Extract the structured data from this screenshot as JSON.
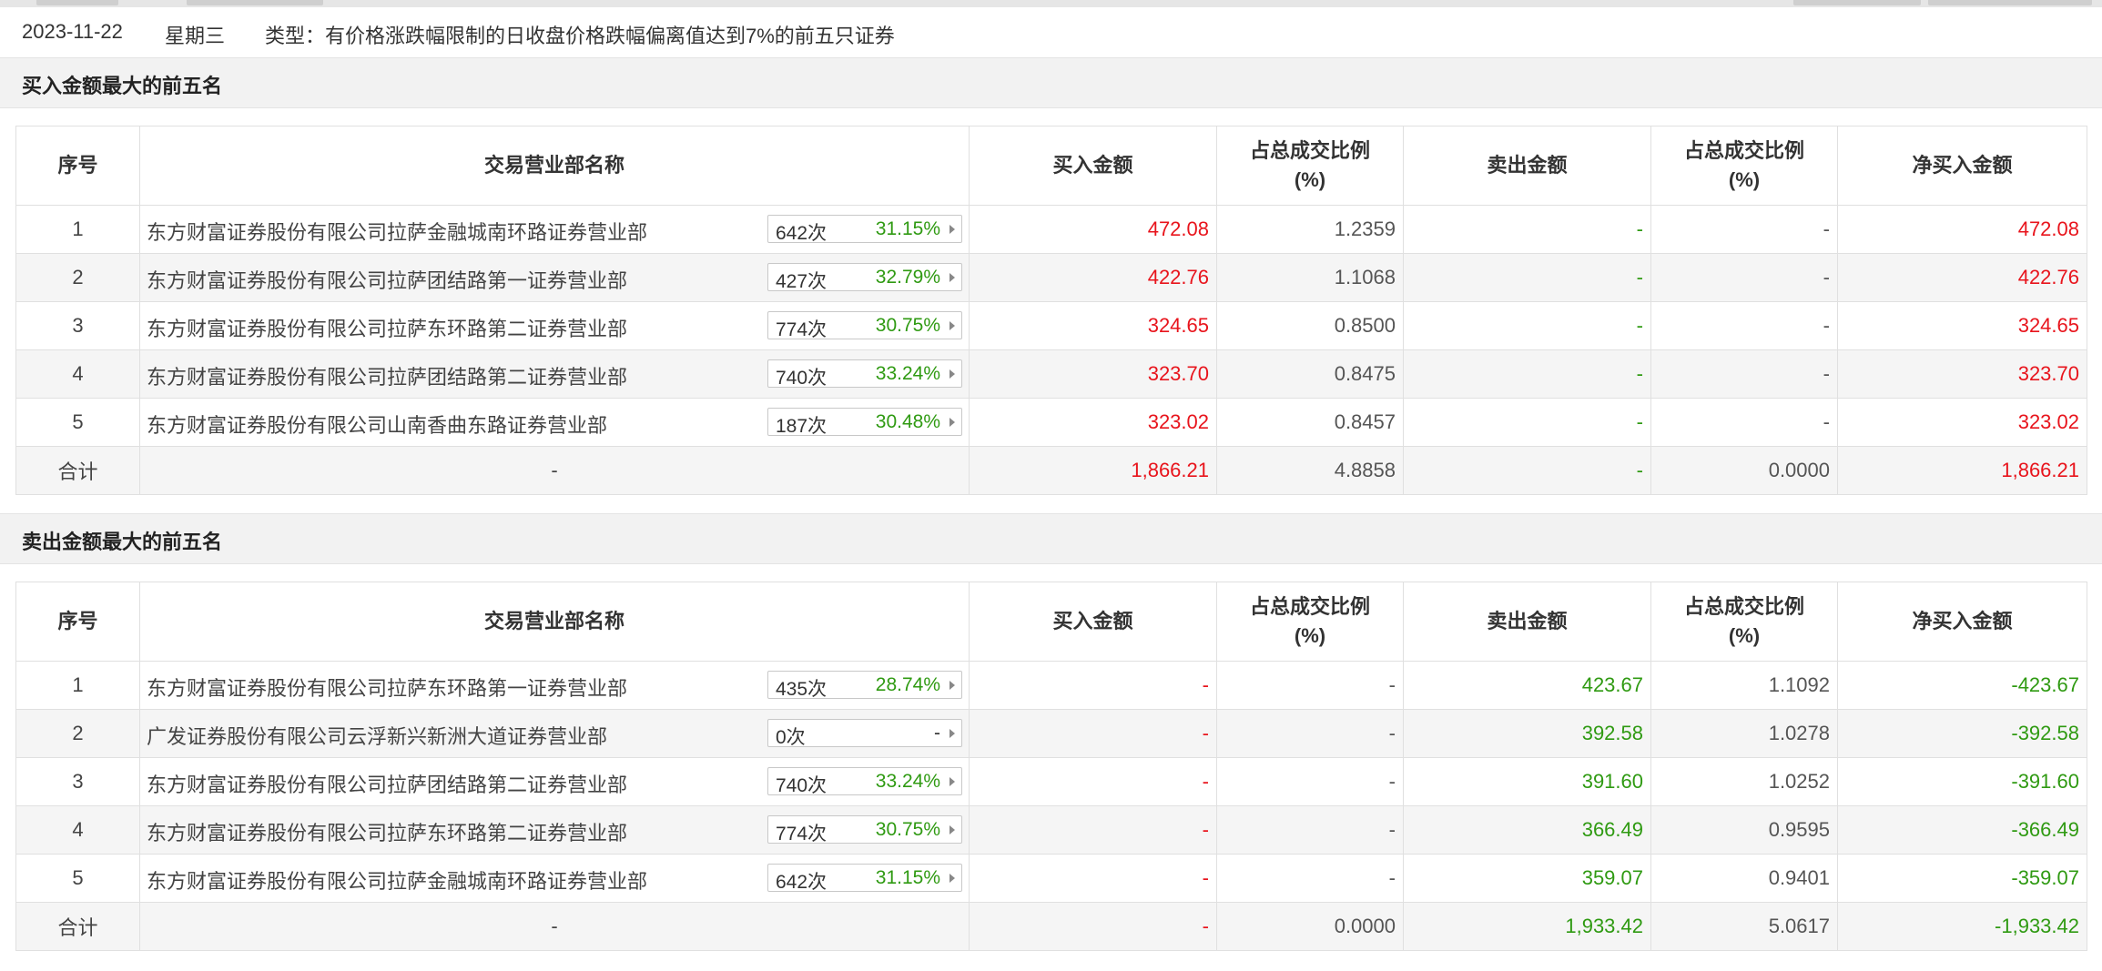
{
  "colors": {
    "red": "#e8141c",
    "green": "#2f9a12"
  },
  "info": {
    "date": "2023-11-22",
    "weekday": "星期三",
    "type_text": "类型：有价格涨跌幅限制的日收盘价格跌幅偏离值达到7%的前五只证券"
  },
  "columns": {
    "seq": "序号",
    "dept": "交易营业部名称",
    "buy": "买入金额",
    "ratio1_line1": "占总成交比例",
    "ratio1_line2": "(%)",
    "sell": "卖出金额",
    "ratio2_line1": "占总成交比例",
    "ratio2_line2": "(%)",
    "net": "净买入金额"
  },
  "buy_section": {
    "title": "买入金额最大的前五名",
    "rows": [
      {
        "seq": "1",
        "name": "东方财富证券股份有限公司拉萨金融城南环路证券营业部",
        "count": "642次",
        "pct": "31.15%",
        "buy": "472.08",
        "buy_ratio": "1.2359",
        "sell": "-",
        "sell_ratio": "-",
        "net": "472.08"
      },
      {
        "seq": "2",
        "name": "东方财富证券股份有限公司拉萨团结路第一证券营业部",
        "count": "427次",
        "pct": "32.79%",
        "buy": "422.76",
        "buy_ratio": "1.1068",
        "sell": "-",
        "sell_ratio": "-",
        "net": "422.76"
      },
      {
        "seq": "3",
        "name": "东方财富证券股份有限公司拉萨东环路第二证券营业部",
        "count": "774次",
        "pct": "30.75%",
        "buy": "324.65",
        "buy_ratio": "0.8500",
        "sell": "-",
        "sell_ratio": "-",
        "net": "324.65"
      },
      {
        "seq": "4",
        "name": "东方财富证券股份有限公司拉萨团结路第二证券营业部",
        "count": "740次",
        "pct": "33.24%",
        "buy": "323.70",
        "buy_ratio": "0.8475",
        "sell": "-",
        "sell_ratio": "-",
        "net": "323.70"
      },
      {
        "seq": "5",
        "name": "东方财富证券股份有限公司山南香曲东路证券营业部",
        "count": "187次",
        "pct": "30.48%",
        "buy": "323.02",
        "buy_ratio": "0.8457",
        "sell": "-",
        "sell_ratio": "-",
        "net": "323.02"
      }
    ],
    "total": {
      "label": "合计",
      "name": "-",
      "buy": "1,866.21",
      "buy_ratio": "4.8858",
      "sell": "-",
      "sell_ratio": "0.0000",
      "net": "1,866.21"
    }
  },
  "sell_section": {
    "title": "卖出金额最大的前五名",
    "rows": [
      {
        "seq": "1",
        "name": "东方财富证券股份有限公司拉萨东环路第一证券营业部",
        "count": "435次",
        "pct": "28.74%",
        "buy": "-",
        "buy_ratio": "-",
        "sell": "423.67",
        "sell_ratio": "1.1092",
        "net": "-423.67"
      },
      {
        "seq": "2",
        "name": "广发证券股份有限公司云浮新兴新洲大道证券营业部",
        "count": "0次",
        "pct": "-",
        "buy": "-",
        "buy_ratio": "-",
        "sell": "392.58",
        "sell_ratio": "1.0278",
        "net": "-392.58"
      },
      {
        "seq": "3",
        "name": "东方财富证券股份有限公司拉萨团结路第二证券营业部",
        "count": "740次",
        "pct": "33.24%",
        "buy": "-",
        "buy_ratio": "-",
        "sell": "391.60",
        "sell_ratio": "1.0252",
        "net": "-391.60"
      },
      {
        "seq": "4",
        "name": "东方财富证券股份有限公司拉萨东环路第二证券营业部",
        "count": "774次",
        "pct": "30.75%",
        "buy": "-",
        "buy_ratio": "-",
        "sell": "366.49",
        "sell_ratio": "0.9595",
        "net": "-366.49"
      },
      {
        "seq": "5",
        "name": "东方财富证券股份有限公司拉萨金融城南环路证券营业部",
        "count": "642次",
        "pct": "31.15%",
        "buy": "-",
        "buy_ratio": "-",
        "sell": "359.07",
        "sell_ratio": "0.9401",
        "net": "-359.07"
      }
    ],
    "total": {
      "label": "合计",
      "name": "-",
      "buy": "-",
      "buy_ratio": "0.0000",
      "sell": "1,933.42",
      "sell_ratio": "5.0617",
      "net": "-1,933.42"
    }
  }
}
